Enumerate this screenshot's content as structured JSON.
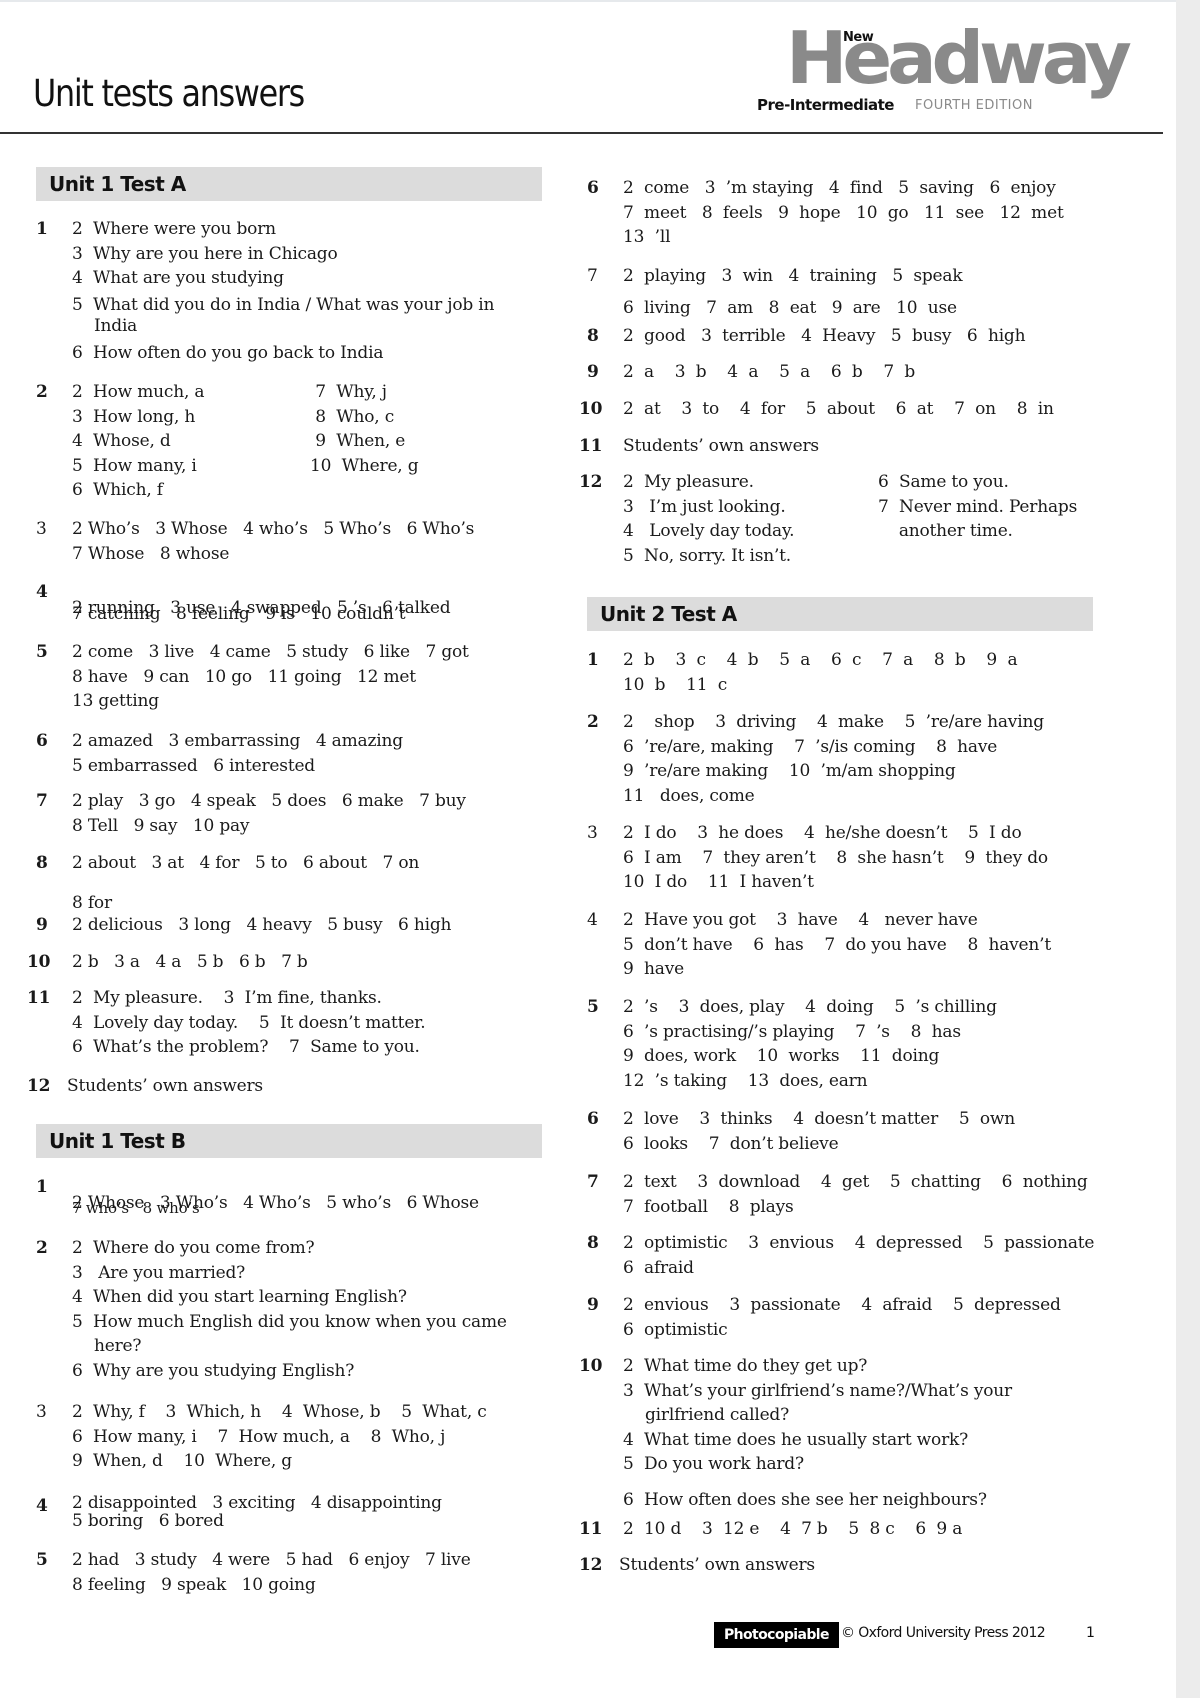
{
  "header": {
    "title": "Unit tests answers",
    "logo": {
      "new": "New",
      "word": "Headway",
      "level": "Pre-Intermediate",
      "edition": "FOURTH EDITION"
    }
  },
  "sections": {
    "u1a": {
      "title": "Unit 1  Test A",
      "q1": {
        "num": "1",
        "lines": [
          "2  Where were you born",
          "3  Why are you here in Chicago",
          "4  What are you studying",
          "5  What did you do in India / What was your job in",
          "India",
          "6  How often do you go back to India"
        ]
      },
      "q2": {
        "num": "2",
        "left": [
          "2  How much, a",
          "3  How long, h",
          "4  Whose, d",
          "5  How many, i",
          "6  Which, f"
        ],
        "right": [
          " 7  Why, j",
          " 8  Who, c",
          " 9  When, e",
          "10  Where, g"
        ]
      },
      "q3": {
        "num": "3",
        "lines": [
          "2 Who’s   3 Whose   4 who’s   5 Who’s   6 Who’s",
          "7 Whose   8 whose"
        ]
      },
      "q4": {
        "num": "4",
        "line_a": "2 running   3 use   4 swapped   5 ’s   6 talked",
        "line_b": "7 catching   8 feeling   9 is   10 couldn’t"
      },
      "q5": {
        "num": "5",
        "lines": [
          "2 come   3 live   4 came   5 study   6 like   7 got",
          "8 have   9 can   10 go   11 going   12 met",
          "13 getting"
        ]
      },
      "q6": {
        "num": "6",
        "lines": [
          "2 amazed   3 embarrassing   4 amazing",
          "5 embarrassed   6 interested"
        ]
      },
      "q7": {
        "num": "7",
        "lines": [
          "2 play   3 go   4 speak   5 does   6 make   7 buy",
          "8 Tell   9 say   10 pay"
        ]
      },
      "q8": {
        "num": "8",
        "lines": [
          "2 about   3 at   4 for   5 to   6 about   7 on",
          "8 for"
        ]
      },
      "q9": {
        "num": "9",
        "lines": [
          "2 delicious   3 long   4 heavy   5 busy   6 high"
        ]
      },
      "q10": {
        "num": "10",
        "lines": [
          "2 b   3 a   4 a   5 b   6 b   7 b"
        ]
      },
      "q11": {
        "num": "11",
        "lines": [
          "2  My pleasure.    3  I’m fine, thanks.",
          "4  Lovely day today.    5  It doesn’t matter.",
          "6  What’s the problem?    7  Same to you."
        ]
      },
      "q12": {
        "num": "12",
        "lines": [
          "Students’ own answers"
        ]
      }
    },
    "u1b": {
      "title": "Unit 1  Test B",
      "q1": {
        "num": "1",
        "line_a": "2 Whose   3 Who’s   4 Who’s   5 who’s   6 Whose",
        "line_b": "7 who’s   8 who’s"
      },
      "q2": {
        "num": "2",
        "lines": [
          "2  Where do you come from?",
          "3   Are you married?",
          "4  When did you start learning English?",
          "5  How much English did you know when you came",
          "here?",
          "6  Why are you studying English?"
        ]
      },
      "q3": {
        "num": "3",
        "lines": [
          "2  Why, f    3  Which, h    4  Whose, b    5  What, c",
          "6  How many, i    7  How much, a    8  Who, j",
          "9  When, d    10  Where, g"
        ]
      },
      "q4": {
        "num": "4",
        "lines": [
          "2 disappointed   3 exciting   4 disappointing",
          "5 boring   6 bored"
        ]
      },
      "q5": {
        "num": "5",
        "lines": [
          "2 had   3 study   4 were   5 had   6 enjoy   7 live",
          "8 feeling   9 speak   10 going"
        ]
      }
    },
    "u1a_cont": {
      "q6": {
        "num": "6",
        "lines": [
          "2  come   3  ’m staying   4  find   5  saving   6  enjoy",
          "7  meet   8  feels   9  hope   10  go   11  see   12  met",
          "13  ’ll"
        ]
      },
      "q7": {
        "num": "7",
        "lines": [
          "2  playing   3  win   4  training   5  speak",
          "6  living   7  am   8  eat   9  are   10  use"
        ]
      },
      "q8": {
        "num": "8",
        "lines": [
          "2  good   3  terrible   4  Heavy   5  busy   6  high"
        ]
      },
      "q9": {
        "num": "9",
        "lines": [
          "2  a    3  b    4  a    5  a    6  b    7  b"
        ]
      },
      "q10": {
        "num": "10",
        "lines": [
          "2  at    3  to    4  for    5  about    6  at    7  on    8  in"
        ]
      },
      "q11": {
        "num": "11",
        "lines": [
          "Students’ own answers"
        ]
      },
      "q12": {
        "num": "12",
        "left": [
          "2  My pleasure.",
          "3   I’m just looking.",
          "4   Lovely day today.",
          "5  No, sorry. It isn’t."
        ],
        "right": [
          "6  Same to you.",
          "7  Never mind. Perhaps",
          "    another time."
        ]
      }
    },
    "u2a": {
      "title": "Unit 2  Test A",
      "q1": {
        "num": "1",
        "lines": [
          "2  b    3  c    4  b    5  a    6  c    7  a    8  b    9  a",
          "10  b    11  c"
        ]
      },
      "q2": {
        "num": "2",
        "lines": [
          "2    shop    3  driving    4  make    5  ’re/are having",
          "6  ’re/are, making    7  ’s/is coming    8  have",
          "9  ’re/are making    10  ’m/am shopping",
          "11   does, come"
        ]
      },
      "q3": {
        "num": "3",
        "lines": [
          "2  I do    3  he does    4  he/she doesn’t    5  I do",
          "6  I am    7  they aren’t    8  she hasn’t    9  they do",
          "10  I do    11  I haven’t"
        ]
      },
      "q4": {
        "num": "4",
        "lines": [
          "2  Have you got    3  have    4   never have",
          "5  don’t have    6  has    7  do you have    8  haven’t",
          "9  have"
        ]
      },
      "q5": {
        "num": "5",
        "lines": [
          "2  ’s    3  does, play    4  doing    5  ’s chilling",
          "6  ’s practising/’s playing    7  ’s    8  has",
          "9  does, work    10  works    11  doing",
          "12  ’s taking    13  does, earn"
        ]
      },
      "q6": {
        "num": "6",
        "lines": [
          "2  love    3  thinks    4  doesn’t matter    5  own",
          "6  looks    7  don’t believe"
        ]
      },
      "q7": {
        "num": "7",
        "lines": [
          "2  text    3  download    4  get    5  chatting    6  nothing",
          "7  football    8  plays"
        ]
      },
      "q8": {
        "num": "8",
        "lines": [
          "2  optimistic    3  envious    4  depressed    5  passionate",
          "6  afraid"
        ]
      },
      "q9": {
        "num": "9",
        "lines": [
          "2  envious    3  passionate    4  afraid    5  depressed",
          "6  optimistic"
        ]
      },
      "q10": {
        "num": "10",
        "lines": [
          "2  What time do they get up?",
          "3  What’s your girlfriend’s name?/What’s your",
          "girlfriend called?",
          "4  What time does he usually start work?",
          "5  Do you work hard?",
          "6  How often does she see her neighbours?"
        ]
      },
      "q11": {
        "num": "11",
        "lines": [
          "2  10 d    3  12 e    4  7 b    5  8 c    6  9 a"
        ]
      },
      "q12": {
        "num": "12",
        "lines": [
          "Students’ own answers"
        ]
      }
    }
  },
  "footer": {
    "badge": "Photocopiable",
    "copyright": "© Oxford University Press 2012",
    "page_number": "1"
  }
}
